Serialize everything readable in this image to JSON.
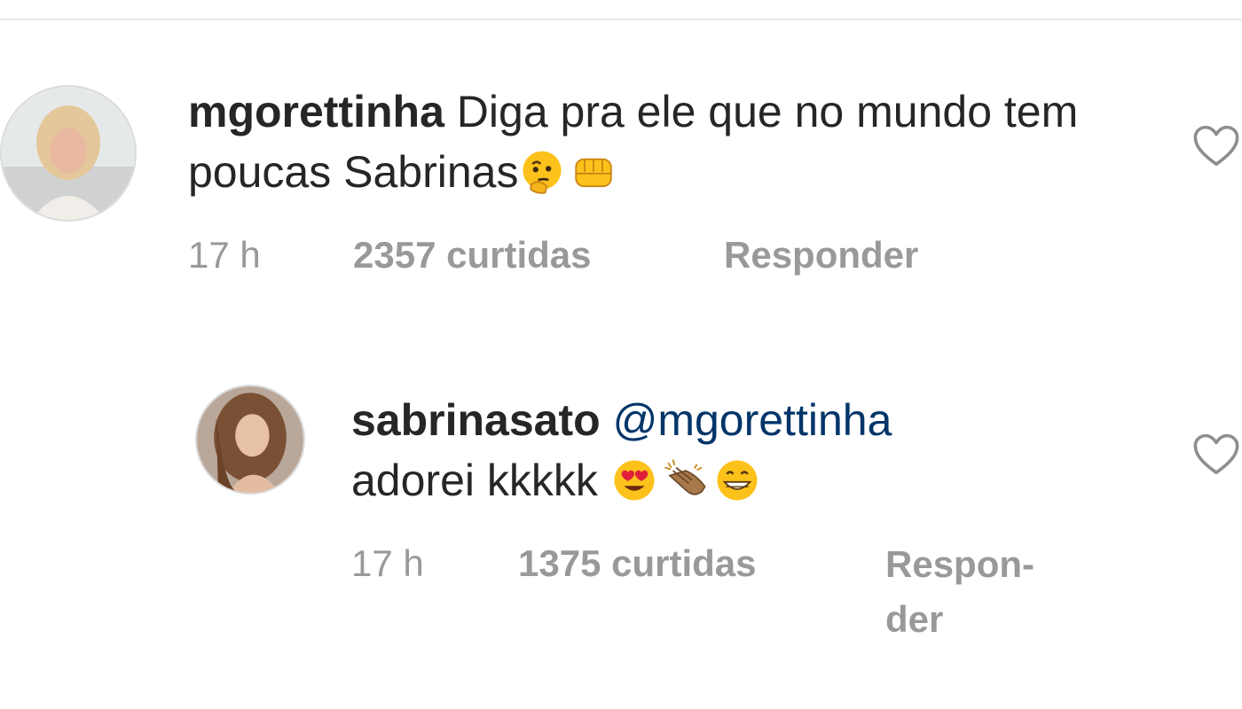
{
  "comments": [
    {
      "username": "mgorettinha",
      "text": " Diga pra ele que no mundo tem poucas Sabrinas",
      "emojis": [
        "thinking-face-emoji",
        "oncoming-fist-emoji"
      ],
      "time": "17 h",
      "likes": "2357 curtidas",
      "reply": "Responder",
      "avatar_icon": "avatar-photo"
    },
    {
      "username": "sabrinasato",
      "mention": "@mgorettinha",
      "text": "adorei kkkkk",
      "emojis": [
        "heart-eyes-emoji",
        "clapping-hands-emoji",
        "grinning-face-emoji"
      ],
      "time": "17 h",
      "likes": "1375 curtidas",
      "reply_line1": "Respon-",
      "reply_line2": "der",
      "avatar_icon": "avatar-photo"
    }
  ],
  "colors": {
    "text": "#262626",
    "meta": "#999999",
    "mention": "#003569",
    "heart_outline": "#8e8e8e"
  }
}
